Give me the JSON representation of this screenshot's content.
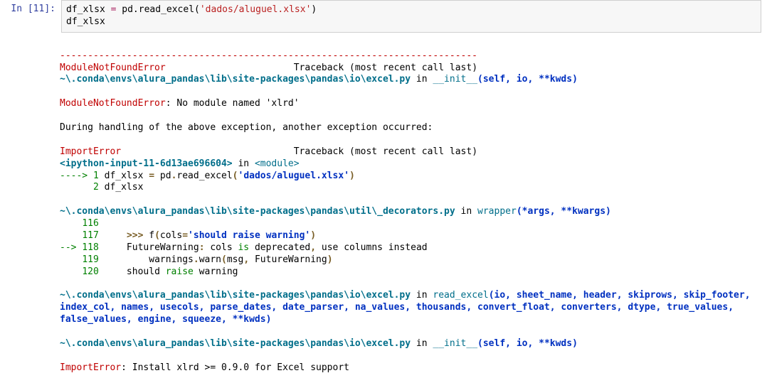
{
  "prompt": "In [11]:",
  "code": {
    "l1_var": "df_xlsx ",
    "l1_eq": "=",
    "l1_mid": " pd.read_excel(",
    "l1_str": "'dados/aluguel.xlsx'",
    "l1_end": ")",
    "l2": "df_xlsx"
  },
  "tb": {
    "dash1": "---------------------------------------------------------------------------",
    "err1_name": "ModuleNotFoundError",
    "err1_pad": "                       ",
    "trace_last": "Traceback (most recent call last)",
    "loc1_a": "~\\.conda\\envs\\alura_pandas\\lib\\site-packages\\pandas\\io\\excel.py",
    "loc1_in": " in ",
    "loc1_fn": "__init__",
    "loc1_sig": "(self, io, **kwds)",
    "err1_line": ": No module named 'xlrd'",
    "during": "During handling of the above exception, another exception occurred:",
    "err2_name": "ImportError",
    "err2_pad": "                               ",
    "ip_loc": "<ipython-input-11-6d13ae696604>",
    "ip_in": " in ",
    "ip_mod": "<module>",
    "arrow1": "----> 1",
    "c1_a": " df_xlsx ",
    "c1_eq": "=",
    "c1_b": " pd",
    "c1_dot1": ".",
    "c1_c": "read_excel",
    "c1_p1": "(",
    "c1_str": "'dados/aluguel.xlsx'",
    "c1_p2": ")",
    "l2_num": "      2",
    "l2_code": " df_xlsx",
    "loc2_a": "~\\.conda\\envs\\alura_pandas\\lib\\site-packages\\pandas\\util\\_decorators.py",
    "loc2_in": " in ",
    "loc2_fn": "wrapper",
    "loc2_sig": "(*args, **kwargs)",
    "n116": "    116",
    "t116": " ",
    "n117": "    117",
    "t117a": "     ",
    "t117b": ">>> ",
    "t117c": "f",
    "t117d": "(",
    "t117e": "cols",
    "t117f": "=",
    "t117g": "'should raise warning'",
    "t117h": ")",
    "n118_arrow": "--> 118",
    "t118a": "     FutureWarning",
    "t118b": ":",
    "t118c": " cols ",
    "t118d": "is",
    "t118e": " deprecated",
    "t118f": ",",
    "t118g": " use columns instead",
    "n119": "    119",
    "t119a": "         warnings",
    "t119b": ".",
    "t119c": "warn",
    "t119d": "(",
    "t119e": "msg",
    "t119f": ",",
    "t119g": " FutureWarning",
    "t119h": ")",
    "n120": "    120",
    "t120a": "     should ",
    "t120b": "raise",
    "t120c": " warning",
    "loc3_a": "~\\.conda\\envs\\alura_pandas\\lib\\site-packages\\pandas\\io\\excel.py",
    "loc3_in": " in ",
    "loc3_fn": "read_excel",
    "loc3_sig": "(io, sheet_name, header, skiprows, skip_footer, index_col, names, usecols, parse_dates, date_parser, na_values, thousands, convert_float, converters, dtype, true_values, false_values, engine, squeeze, **kwds)",
    "loc4_a": "~\\.conda\\envs\\alura_pandas\\lib\\site-packages\\pandas\\io\\excel.py",
    "loc4_in": " in ",
    "loc4_fn": "__init__",
    "loc4_sig": "(self, io, **kwds)",
    "final_err_name": "ImportError",
    "final_err_msg": ": Install xlrd >= 0.9.0 for Excel support"
  }
}
